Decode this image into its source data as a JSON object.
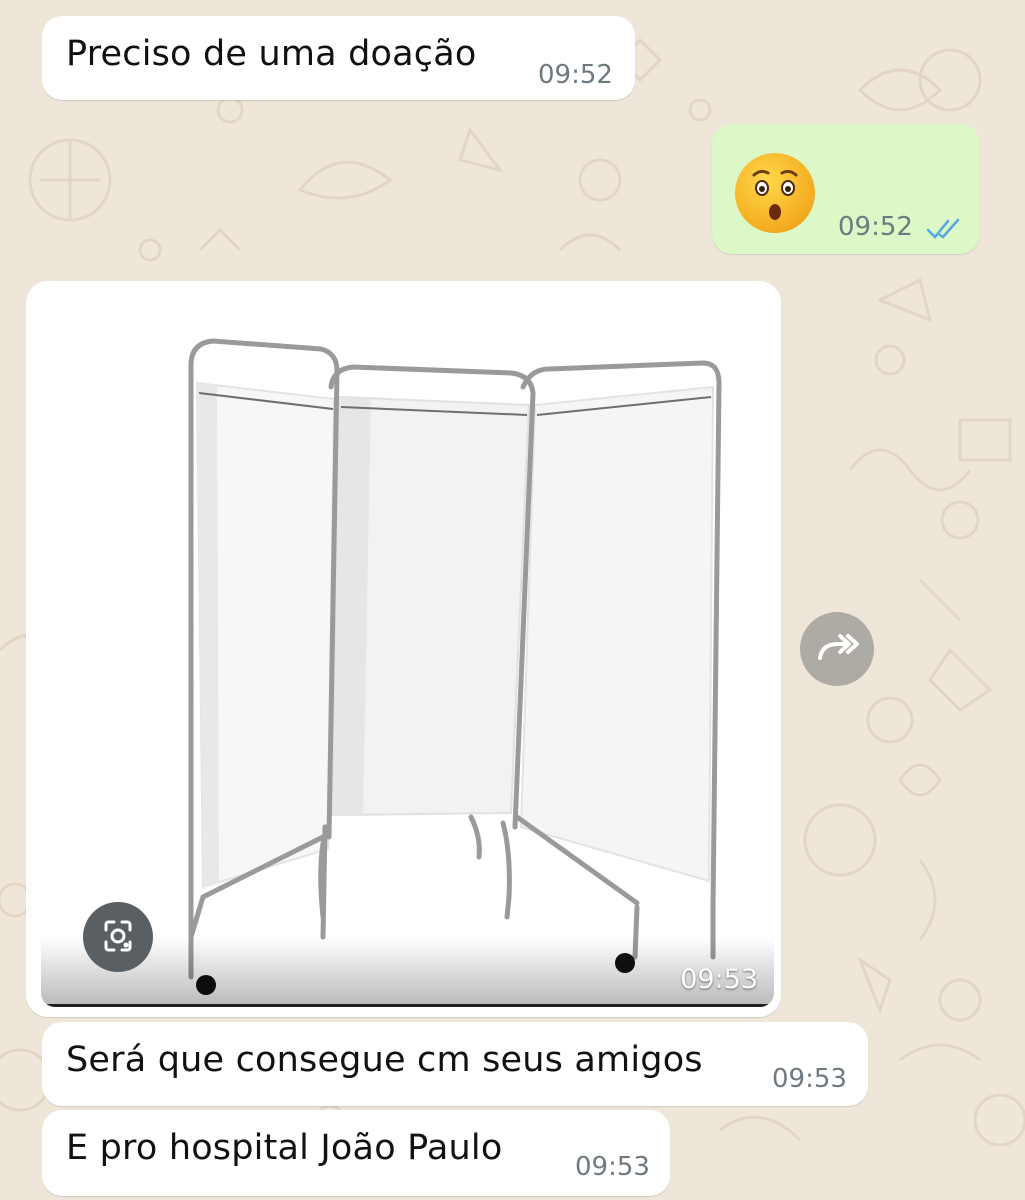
{
  "messages": [
    {
      "direction": "incoming",
      "text": "Preciso de uma doação",
      "time": "09:52"
    },
    {
      "direction": "outgoing",
      "emoji": "hushed-face",
      "time": "09:52",
      "status": "read"
    },
    {
      "direction": "incoming",
      "type": "image",
      "image_subject": "folding-screen",
      "time": "09:53"
    },
    {
      "direction": "incoming",
      "text": "Será que consegue cm seus amigos",
      "time": "09:53"
    },
    {
      "direction": "incoming",
      "text": "E pro hospital João Paulo",
      "time": "09:53"
    }
  ],
  "icons": {
    "forward": "forward-icon",
    "lens": "lens-search-icon",
    "read_ticks": "double-check-icon"
  },
  "colors": {
    "wallpaper": "#efe6da",
    "incoming_bubble": "#ffffff",
    "outgoing_bubble": "#dcf8c6",
    "read_tick": "#4fa7e6",
    "timestamp": "#6f7a80"
  }
}
